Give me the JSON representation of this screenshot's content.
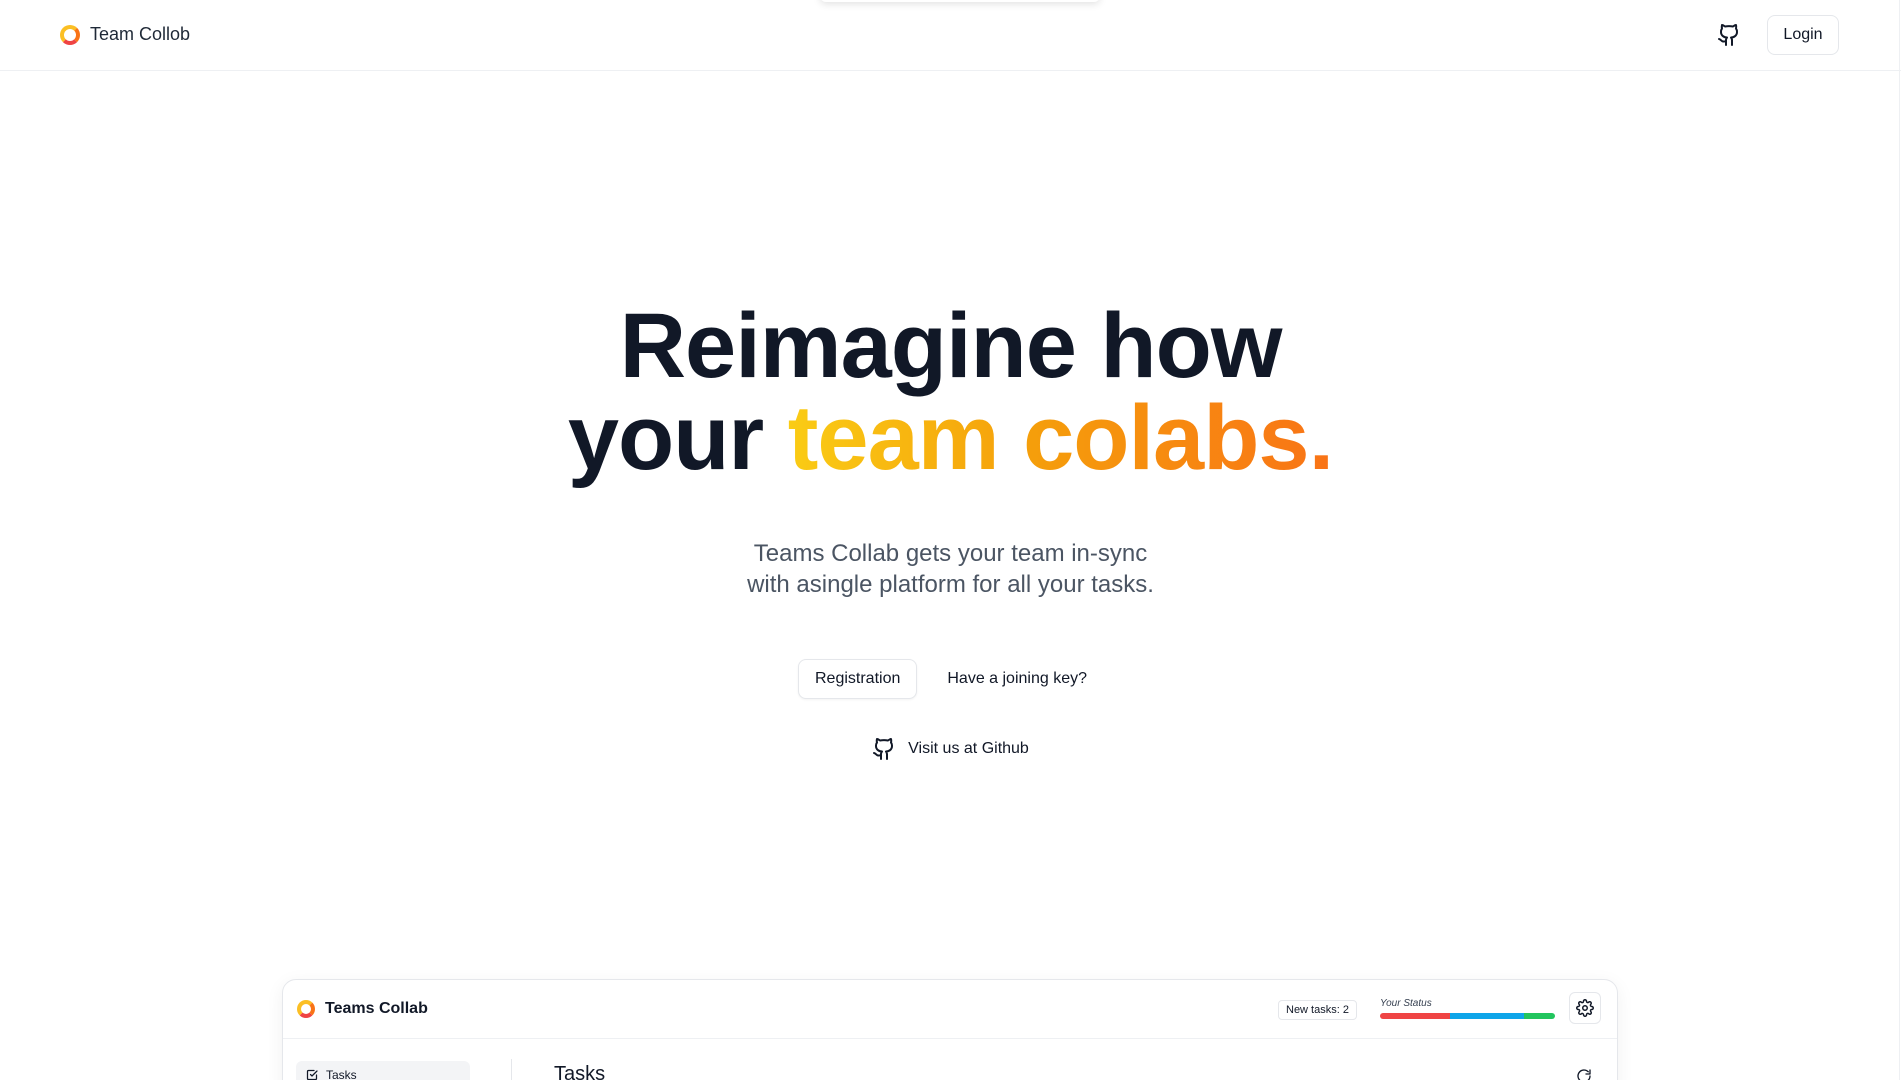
{
  "header": {
    "brand": "Team Collob",
    "login_label": "Login"
  },
  "hero": {
    "title_line1": "Reimagine how",
    "title_line2_plain": "your ",
    "title_line2_accent": "team colabs.",
    "subtitle_line1": "Teams Collab gets your team in-sync",
    "subtitle_line2": "with asingle platform for all your tasks.",
    "registration_label": "Registration",
    "joining_key_label": "Have a joining key?",
    "github_link_label": "Visit us at Github"
  },
  "preview": {
    "brand": "Teams Collab",
    "new_tasks": "New tasks: 2",
    "status_label": "Your Status",
    "sidebar_item": "Tasks",
    "page_title": "Tasks"
  },
  "colors": {
    "accent_start": "#facc15",
    "accent_end": "#f97316",
    "text_dark": "#111827",
    "status_red": "#ef4444",
    "status_blue": "#0ea5e9",
    "status_green": "#22c55e"
  },
  "icons": [
    "logo-icon",
    "github-icon",
    "settings-gear-icon",
    "checkbox-icon",
    "refresh-icon"
  ]
}
